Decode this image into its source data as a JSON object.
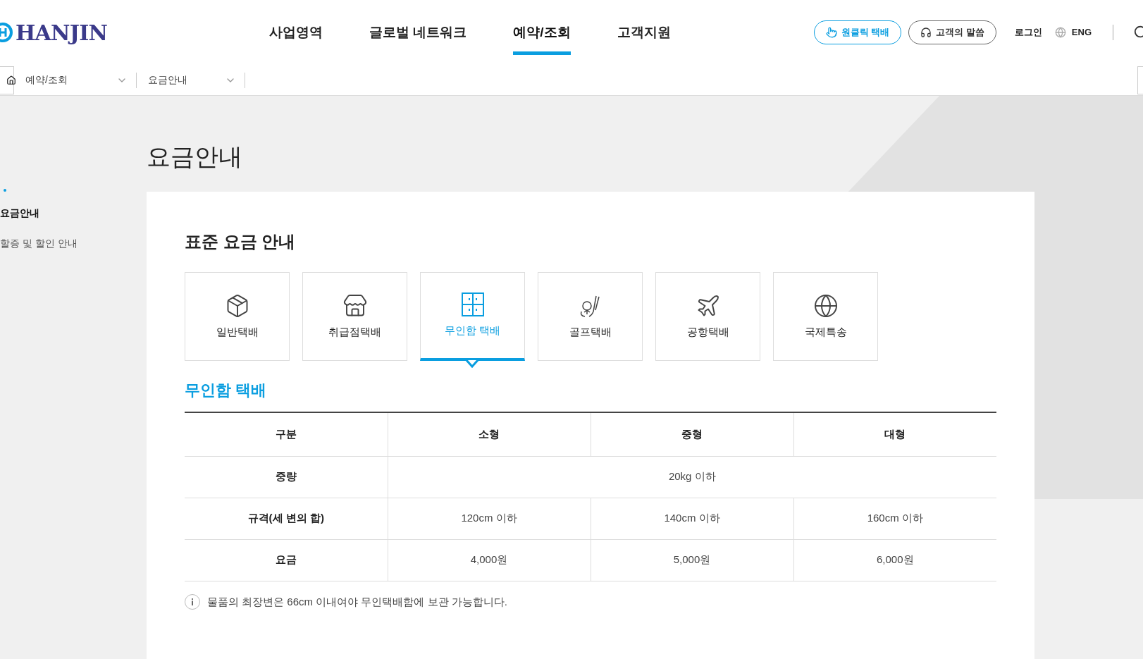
{
  "header": {
    "logo": "HANJIN",
    "nav": [
      {
        "label": "사업영역",
        "selected": false
      },
      {
        "label": "글로벌 네트워크",
        "selected": false
      },
      {
        "label": "예약/조회",
        "selected": true
      },
      {
        "label": "고객지원",
        "selected": false
      }
    ],
    "buttons": [
      {
        "label": "원클릭 택배",
        "kind": "primary"
      },
      {
        "label": "고객의 말씀",
        "kind": "outline"
      }
    ],
    "login": "로그인",
    "language": "ENG"
  },
  "breadcrumb": [
    "예약/조회",
    "요금안내"
  ],
  "page_title": "요금안내",
  "sidebar": {
    "items": [
      {
        "label": "요금안내",
        "selected": true
      },
      {
        "label": "할증 및 할인 안내",
        "selected": false
      }
    ]
  },
  "content": {
    "heading": "표준 요금 안내",
    "tabs": [
      {
        "label": "일반택배",
        "selected": false
      },
      {
        "label": "취급점택배",
        "selected": false
      },
      {
        "label": "무인함 택배",
        "selected": true
      },
      {
        "label": "골프택배",
        "selected": false
      },
      {
        "label": "공항택배",
        "selected": false
      },
      {
        "label": "국제특송",
        "selected": false
      }
    ],
    "section_title": "무인함 택배",
    "table": {
      "columns": [
        "구분",
        "소형",
        "중형",
        "대형"
      ],
      "rows": [
        [
          "중량",
          {
            "text": "20kg 이하",
            "colspan": 3
          }
        ],
        [
          "규격(세 변의 합)",
          "120cm 이하",
          "140cm 이하",
          "160cm 이하"
        ],
        [
          "요금",
          "4,000원",
          "5,000원",
          "6,000원"
        ]
      ]
    },
    "note": "물품의 최장변은 66cm 이내여야 무인택배함에 보관 가능합니다."
  }
}
